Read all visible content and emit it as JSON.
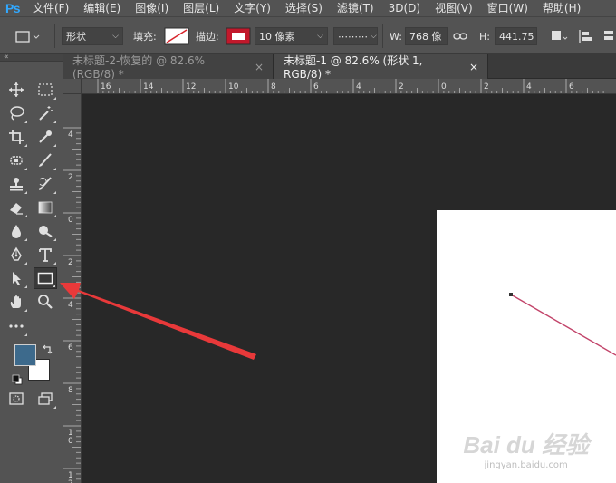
{
  "app": {
    "logo": "Ps"
  },
  "menu": [
    "文件(F)",
    "编辑(E)",
    "图像(I)",
    "图层(L)",
    "文字(Y)",
    "选择(S)",
    "滤镜(T)",
    "3D(D)",
    "视图(V)",
    "窗口(W)",
    "帮助(H)"
  ],
  "options": {
    "mode_value": "形状",
    "fill_label": "填充:",
    "stroke_label": "描边:",
    "stroke_width": "10 像素",
    "stroke_style": "⋯⋯⋯",
    "width_label": "W:",
    "width_value": "768 像",
    "height_label": "H:",
    "height_value": "441.75"
  },
  "tabs": [
    {
      "label": "未标题-2-恢复的 @ 82.6%(RGB/8) *",
      "close": "×"
    },
    {
      "label": "未标题-1 @ 82.6% (形状 1, RGB/8) *",
      "close": "×"
    }
  ],
  "ruler": {
    "h_labels": [
      "16",
      "14",
      "12",
      "10",
      "8",
      "6",
      "4",
      "2",
      "0",
      "2",
      "4",
      "6"
    ],
    "v_labels": [
      "4",
      "2",
      "0",
      "2",
      "4",
      "6",
      "8",
      "10",
      "12"
    ]
  },
  "tools": [
    "move-tool",
    "marquee-tool",
    "lasso-tool",
    "magic-wand-tool",
    "crop-tool",
    "eyedropper-tool",
    "spot-healing-tool",
    "brush-tool",
    "clone-stamp-tool",
    "history-brush-tool",
    "eraser-tool",
    "gradient-tool",
    "blur-tool",
    "dodge-tool",
    "pen-tool",
    "type-tool",
    "path-selection-tool",
    "rectangle-tool",
    "hand-tool",
    "zoom-tool",
    "more-tools"
  ],
  "colors": {
    "foreground": "#3d6a8c",
    "background": "#ffffff",
    "arrow": "#e8393a",
    "line": "#c2446a"
  },
  "watermark": {
    "logo": "Bai du 经验",
    "sub": "jingyan.baidu.com"
  }
}
